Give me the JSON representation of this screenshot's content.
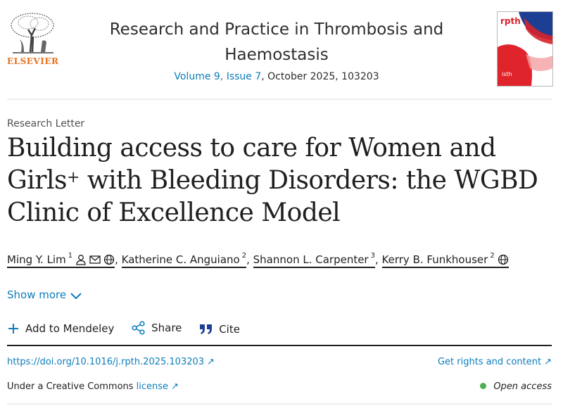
{
  "header": {
    "publisher": "ELSEVIER",
    "journal_title_line1": "Research and Practice in Thrombosis and",
    "journal_title_line2": "Haemostasis",
    "volume_issue": "Volume 9, Issue 7",
    "date_article": ", October 2025, 103203",
    "cover_text": "rpth",
    "cover_small": "isth"
  },
  "article": {
    "type": "Research Letter",
    "title_part1": "Building access to care for Women and Girls",
    "title_sup": "+",
    "title_part2": " with Bleeding Disorders: the WGBD Clinic of Excellence Model",
    "authors": [
      {
        "name": "Ming Y. Lim",
        "sup": "1"
      },
      {
        "name": "Katherine C. Anguiano",
        "sup": "2"
      },
      {
        "name": "Shannon L. Carpenter",
        "sup": "3"
      },
      {
        "name": "Kerry B. Funkhouser",
        "sup": "2"
      }
    ],
    "separator": ",",
    "show_more": "Show more"
  },
  "actions": {
    "mendeley": "Add to Mendeley",
    "share": "Share",
    "cite": "Cite"
  },
  "links": {
    "doi": "https://doi.org/10.1016/j.rpth.2025.103203",
    "rights": "Get rights and content",
    "cc_text": "Under a Creative Commons ",
    "cc_link": "license",
    "open_access": "Open access"
  },
  "colors": {
    "link": "#0c7dbb",
    "elsevier_orange": "#e9711c",
    "open_access_dot": "#4caf50"
  }
}
